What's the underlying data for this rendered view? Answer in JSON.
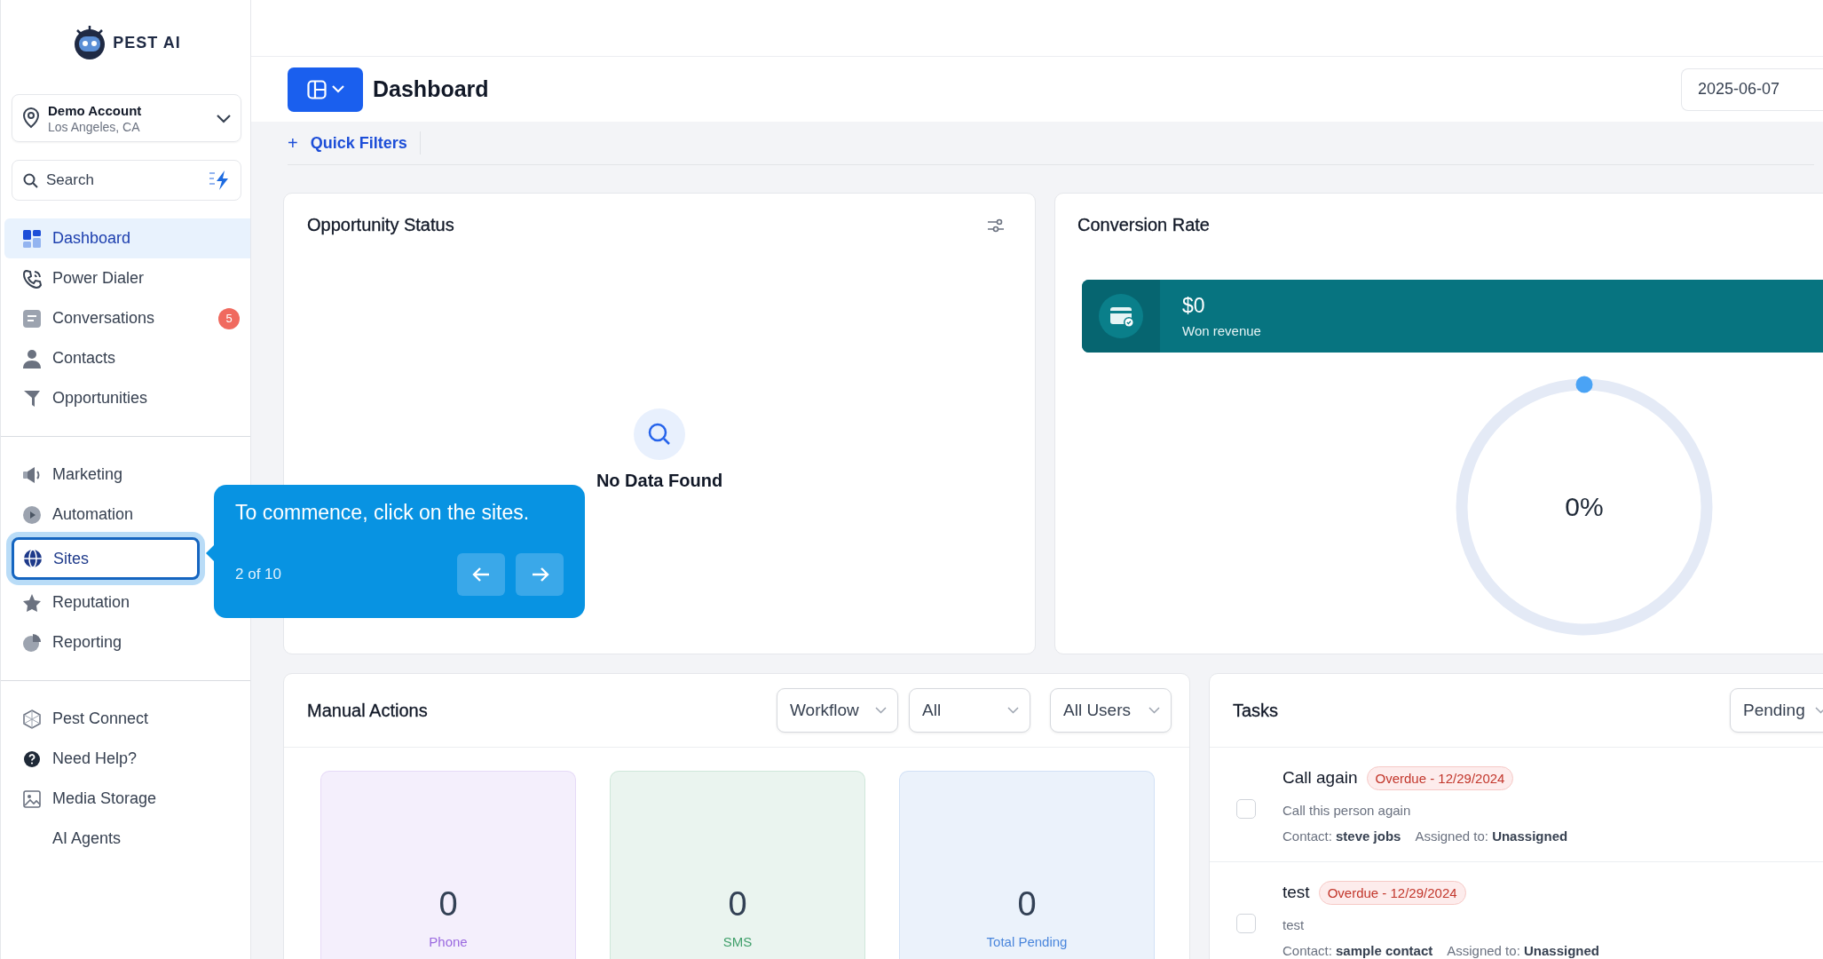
{
  "brand": {
    "name": "PEST AI"
  },
  "account": {
    "name": "Demo Account",
    "location": "Los Angeles, CA"
  },
  "search": {
    "placeholder": "Search"
  },
  "nav_groups": [
    [
      {
        "label": "Dashboard",
        "selected": true,
        "tour_target": false
      },
      {
        "label": "Power Dialer",
        "selected": false,
        "tour_target": false
      },
      {
        "label": "Conversations",
        "selected": false,
        "tour_target": false,
        "badge": "5"
      },
      {
        "label": "Contacts",
        "selected": false,
        "tour_target": false
      },
      {
        "label": "Opportunities",
        "selected": false,
        "tour_target": false
      }
    ],
    [
      {
        "label": "Marketing",
        "selected": false,
        "tour_target": false
      },
      {
        "label": "Automation",
        "selected": false,
        "tour_target": false
      },
      {
        "label": "Sites",
        "selected": false,
        "tour_target": true
      },
      {
        "label": "Reputation",
        "selected": false,
        "tour_target": false
      },
      {
        "label": "Reporting",
        "selected": false,
        "tour_target": false
      }
    ],
    [
      {
        "label": "Pest Connect",
        "selected": false,
        "tour_target": false
      },
      {
        "label": "Need Help?",
        "selected": false,
        "tour_target": false
      },
      {
        "label": "Media Storage",
        "selected": false,
        "tour_target": false
      },
      {
        "label": "AI Agents",
        "selected": false,
        "tour_target": false
      }
    ]
  ],
  "header": {
    "title": "Dashboard",
    "date": "2025-06-07"
  },
  "quick_filters": {
    "symbol": "+",
    "label": "Quick Filters"
  },
  "opportunity_status": {
    "title": "Opportunity Status",
    "empty_text": "No Data Found"
  },
  "conversion_rate": {
    "title": "Conversion Rate",
    "revenue": {
      "value": "$0",
      "label": "Won revenue"
    },
    "rate": {
      "reading": "0%"
    }
  },
  "manual_actions": {
    "title": "Manual Actions",
    "filters": [
      "Workflow",
      "All",
      "All Users"
    ],
    "tiles": [
      {
        "value": "0",
        "label": "Phone",
        "color": "#9b6ae0"
      },
      {
        "value": "0",
        "label": "SMS",
        "color": "#3f9f6a"
      },
      {
        "value": "0",
        "label": "Total Pending",
        "color": "#4a86dc"
      }
    ]
  },
  "tasks": {
    "title": "Tasks",
    "filters": [
      "Pending"
    ],
    "items": [
      {
        "title": "Call again",
        "due": "Overdue - 12/29/2024",
        "description": "Call this person again",
        "contact": "Contact: **steve jobs**",
        "assigned": "Assigned to: **Unassigned**",
        "checked": false
      },
      {
        "title": "test",
        "due": "Overdue - 12/29/2024",
        "description": "test",
        "contact": "Contact: **sample contact**",
        "assigned": "Assigned to: **Unassigned**",
        "checked": false
      }
    ]
  },
  "tour": {
    "text": "To commence, click on the sites.",
    "step": "2 of 10"
  }
}
